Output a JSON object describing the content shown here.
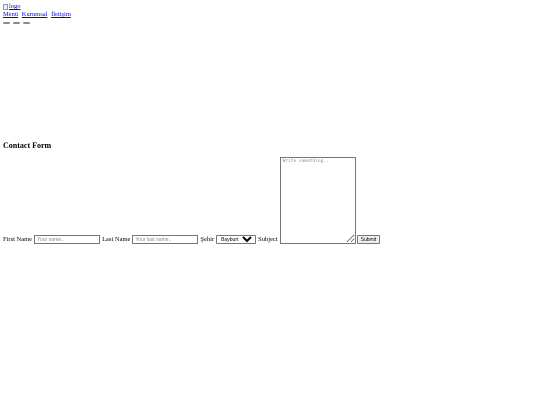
{
  "header": {
    "logo_alt": "logo"
  },
  "nav": {
    "items": [
      "Menü",
      "Kurumsal",
      "İletişim"
    ]
  },
  "form": {
    "title": "Contact Form",
    "first_name_label": "First Name",
    "first_name_placeholder": "Your name..",
    "last_name_label": "Last Name",
    "last_name_placeholder": "Your last name..",
    "city_label": "Şehir",
    "city_selected": "Bayburt",
    "subject_label": "Subject",
    "subject_placeholder": "Write something..",
    "submit_label": "Submit"
  }
}
